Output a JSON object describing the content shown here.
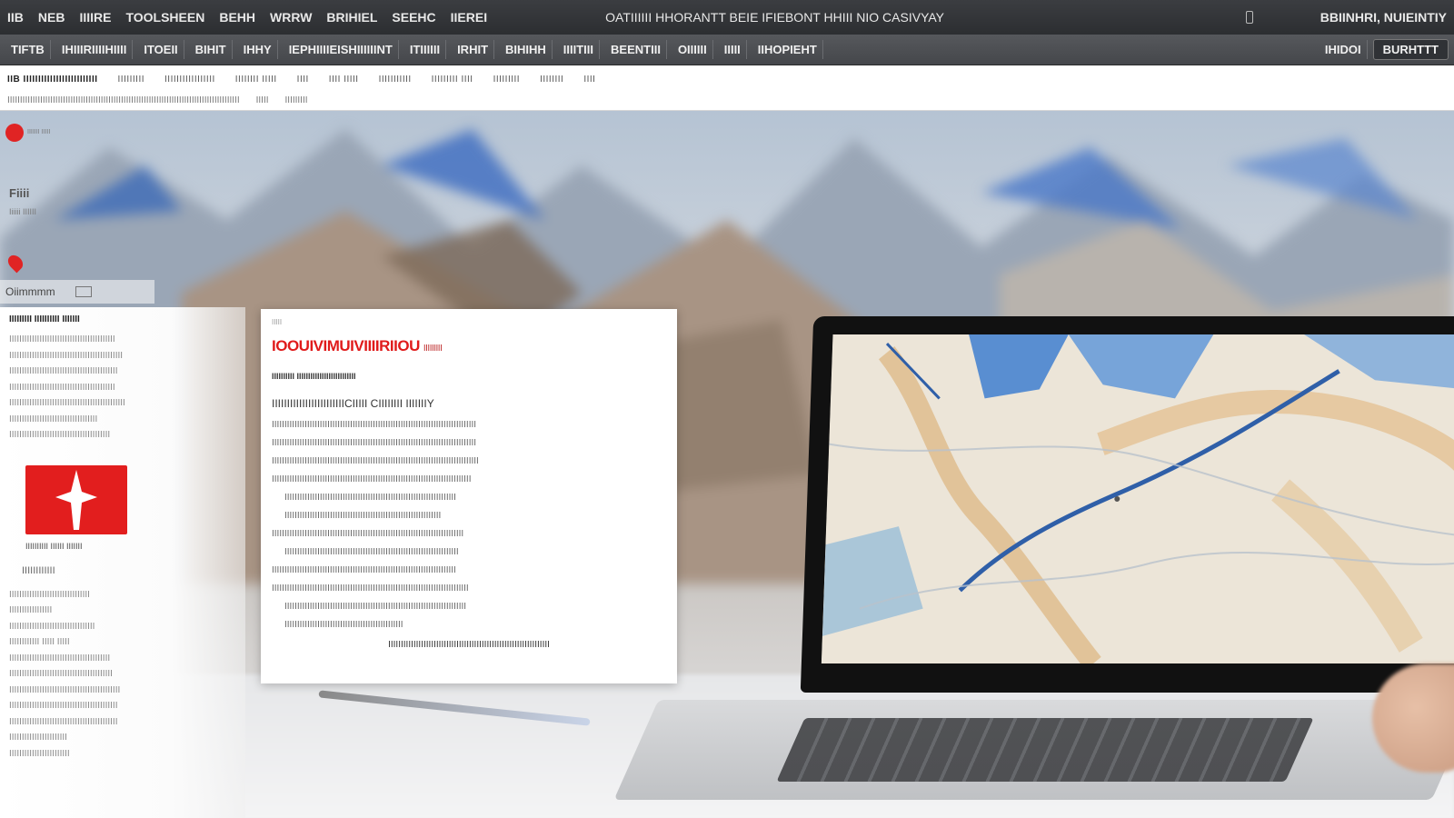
{
  "menubar": {
    "items": [
      "IIB",
      "NEB",
      "IIIIRE",
      "TOOLSHEEN",
      "BEHH",
      "WRRW",
      "BRIHIEL",
      "SEEHC",
      "IIEREI"
    ],
    "center_text": "OATIIIIII HHORANTT BEIE IFIEBONT HHIII NIO CASIVYAY",
    "right_text": "BBIINHRI, NUIEINTIY"
  },
  "toolbar": {
    "items": [
      "TIFTB",
      "IHIIIRIIIIHIIII",
      "ITOEII",
      "BIHIT",
      "IHHY",
      "IEPHIIIIEISHIIIIIINT",
      "ITIIIIII",
      "IRHIT",
      "BIHIHH",
      "IIIITIII",
      "BEENTIII",
      "OIIIIII",
      "IIIII",
      "IIHOPIEHT"
    ],
    "right_items": [
      "IHIDOI"
    ],
    "action_label": "BURHTTT"
  },
  "ticker": {
    "row1": [
      "IIB IIIIIIIIIIIIIIIIIIIIIIIII",
      "IIIIIIIII",
      "IIIIIIIIIIIIIIIII",
      "IIIIIIII IIIII",
      "IIII",
      "IIII IIIII",
      "IIIIIIIIIII",
      "IIIIIIIII IIII",
      "IIIIIIIII",
      "IIIIIIII",
      "IIII"
    ],
    "row2": [
      "IIIIIIIIIIIIIIIIIIIIIIIIIIIIIIIIIIIIIIIIIIIIIIIIIIIIIIIIIIIIIIIIIIIIIIIIIIIIIIIIIIIIIIIIIIII",
      "IIIII",
      "IIIIIIIII"
    ]
  },
  "brand": {
    "small_text": "IIIIIII IIIII"
  },
  "side": {
    "label": "Fiiii",
    "sublabel": "Iiiiii IIIIII",
    "tab_label": "Oiimmmm"
  },
  "left_panel": {
    "title": "IIIIIIIII IIIIIIIIII IIIIIII",
    "lines_top": [
      "IIIIIIIIIIIIIIIIIIIIIIIIIIIIIIIIIIIIIIIIII",
      "IIIIIIIIIIIIIIIIIIIIIIIIIIIIIIIIIIIIIIIIIIIII",
      "IIIIIIIIIIIIIIIIIIIIIIIIIIIIIIIIIIIIIIIIIII",
      "IIIIIIIIIIIIIIIIIIIIIIIIIIIIIIIIIIIIIIIIII",
      "IIIIIIIIIIIIIIIIIIIIIIIIIIIIIIIIIIIIIIIIIIIIII",
      "IIIIIIIIIIIIIIIIIIIIIIIIIIIIIIIIIII",
      "IIIIIIIIIIIIIIIIIIIIIIIIIIIIIIIIIIIIIIII"
    ],
    "flag_caption": "IIIIIIIIII IIIIII  IIIIIII",
    "sub_heading": "IIIIIIIIIIII",
    "lines_bottom": [
      "IIIIIIIIIIIIIIIIIIIIIIIIIIIIIIII",
      "IIIIIIIIIIIIIIIII",
      "IIIIIIIIIIIIIIIIIIIIIIIIIIIIIIIIII",
      "IIIIIIIIIIII IIIII IIIII",
      "IIIIIIIIIIIIIIIIIIIIIIIIIIIIIIIIIIIIIIII",
      "IIIIIIIIIIIIIIIIIIIIIIIIIIIIIIIIIIIIIIIII",
      "IIIIIIIIIIIIIIIIIIIIIIIIIIIIIIIIIIIIIIIIIIII",
      "IIIIIIIIIIIIIIIIIIIIIIIIIIIIIIIIIIIIIIIIIII",
      "IIIIIIIIIIIIIIIIIIIIIIIIIIIIIIIIIIIIIIIIIII",
      "IIIIIIIIIIIIIIIIIIIIIII",
      "IIIIIIIIIIIIIIIIIIIIIIII"
    ]
  },
  "card": {
    "kicker": "IIIII",
    "headline": "IOOUIVIMUIVIIIIRIIOU",
    "headline_suffix": "IIIIIIIII",
    "byline": "IIIIIIIIII IIIIIIIIIIIIIIIIIIIIIIIIII",
    "deck": "IIIIIIIIIIIIIIIIIIIIIIIICIIIII CIIIIIIII IIIIIIIY",
    "paragraphs": [
      "IIIIIIIIIIIIIIIIIIIIIIIIIIIIIIIIIIIIIIIIIIIIIIIIIIIIIIIIIIIIIIIIIIIIIIIIIIIIIIIII",
      "IIIIIIIIIIIIIIIIIIIIIIIIIIIIIIIIIIIIIIIIIIIIIIIIIIIIIIIIIIIIIIIIIIIIIIIIIIIIIIIII",
      "IIIIIIIIIIIIIIIIIIIIIIIIIIIIIIIIIIIIIIIIIIIIIIIIIIIIIIIIIIIIIIIIIIIIIIIIIIIIIIIIII",
      "IIIIIIIIIIIIIIIIIIIIIIIIIIIIIIIIIIIIIIIIIIIIIIIIIIIIIIIIIIIIIIIIIIIIIIIIIIIIIII",
      "IIIIIIIIIIIIIIIIIIIIIIIIIIIIIIIIIIIIIIIIIIIIIIIIIIIIIIIIIIIIIIIIIIII",
      "IIIIIIIIIIIIIIIIIIIIIIIIIIIIIIIIIIIIIIIIIIIIIIIIIIIIIIIIIIIIII",
      "IIIIIIIIIIIIIIIIIIIIIIIIIIIIIIIIIIIIIIIIIIIIIIIIIIIIIIIIIIIIIIIIIIIIIIIIIIII",
      "IIIIIIIIIIIIIIIIIIIIIIIIIIIIIIIIIIIIIIIIIIIIIIIIIIIIIIIIIIIIIIIIIIIII",
      "IIIIIIIIIIIIIIIIIIIIIIIIIIIIIIIIIIIIIIIIIIIIIIIIIIIIIIIIIIIIIIIIIIIIIIIII",
      "IIIIIIIIIIIIIIIIIIIIIIIIIIIIIIIIIIIIIIIIIIIIIIIIIIIIIIIIIIIIIIIIIIIIIIIIIIIIII",
      "IIIIIIIIIIIIIIIIIIIIIIIIIIIIIIIIIIIIIIIIIIIIIIIIIIIIIIIIIIIIIIIIIIIIIIII",
      "IIIIIIIIIIIIIIIIIIIIIIIIIIIIIIIIIIIIIIIIIIIIIII"
    ],
    "footer": "IIIIIIIIIIIIIIIIIIIIIIIIIIIIIIIIIIIIIIIIIIIIIIIIIIIIIIIIIIIIIIII"
  },
  "colors": {
    "accent_red": "#e01b1b",
    "menubar_bg": "#2f3134",
    "toolbar_bg": "#4b4d51"
  },
  "icons": [
    "battery-icon",
    "flag-star-icon",
    "brand-logo-icon",
    "map-pin-icon",
    "grid-icon"
  ]
}
